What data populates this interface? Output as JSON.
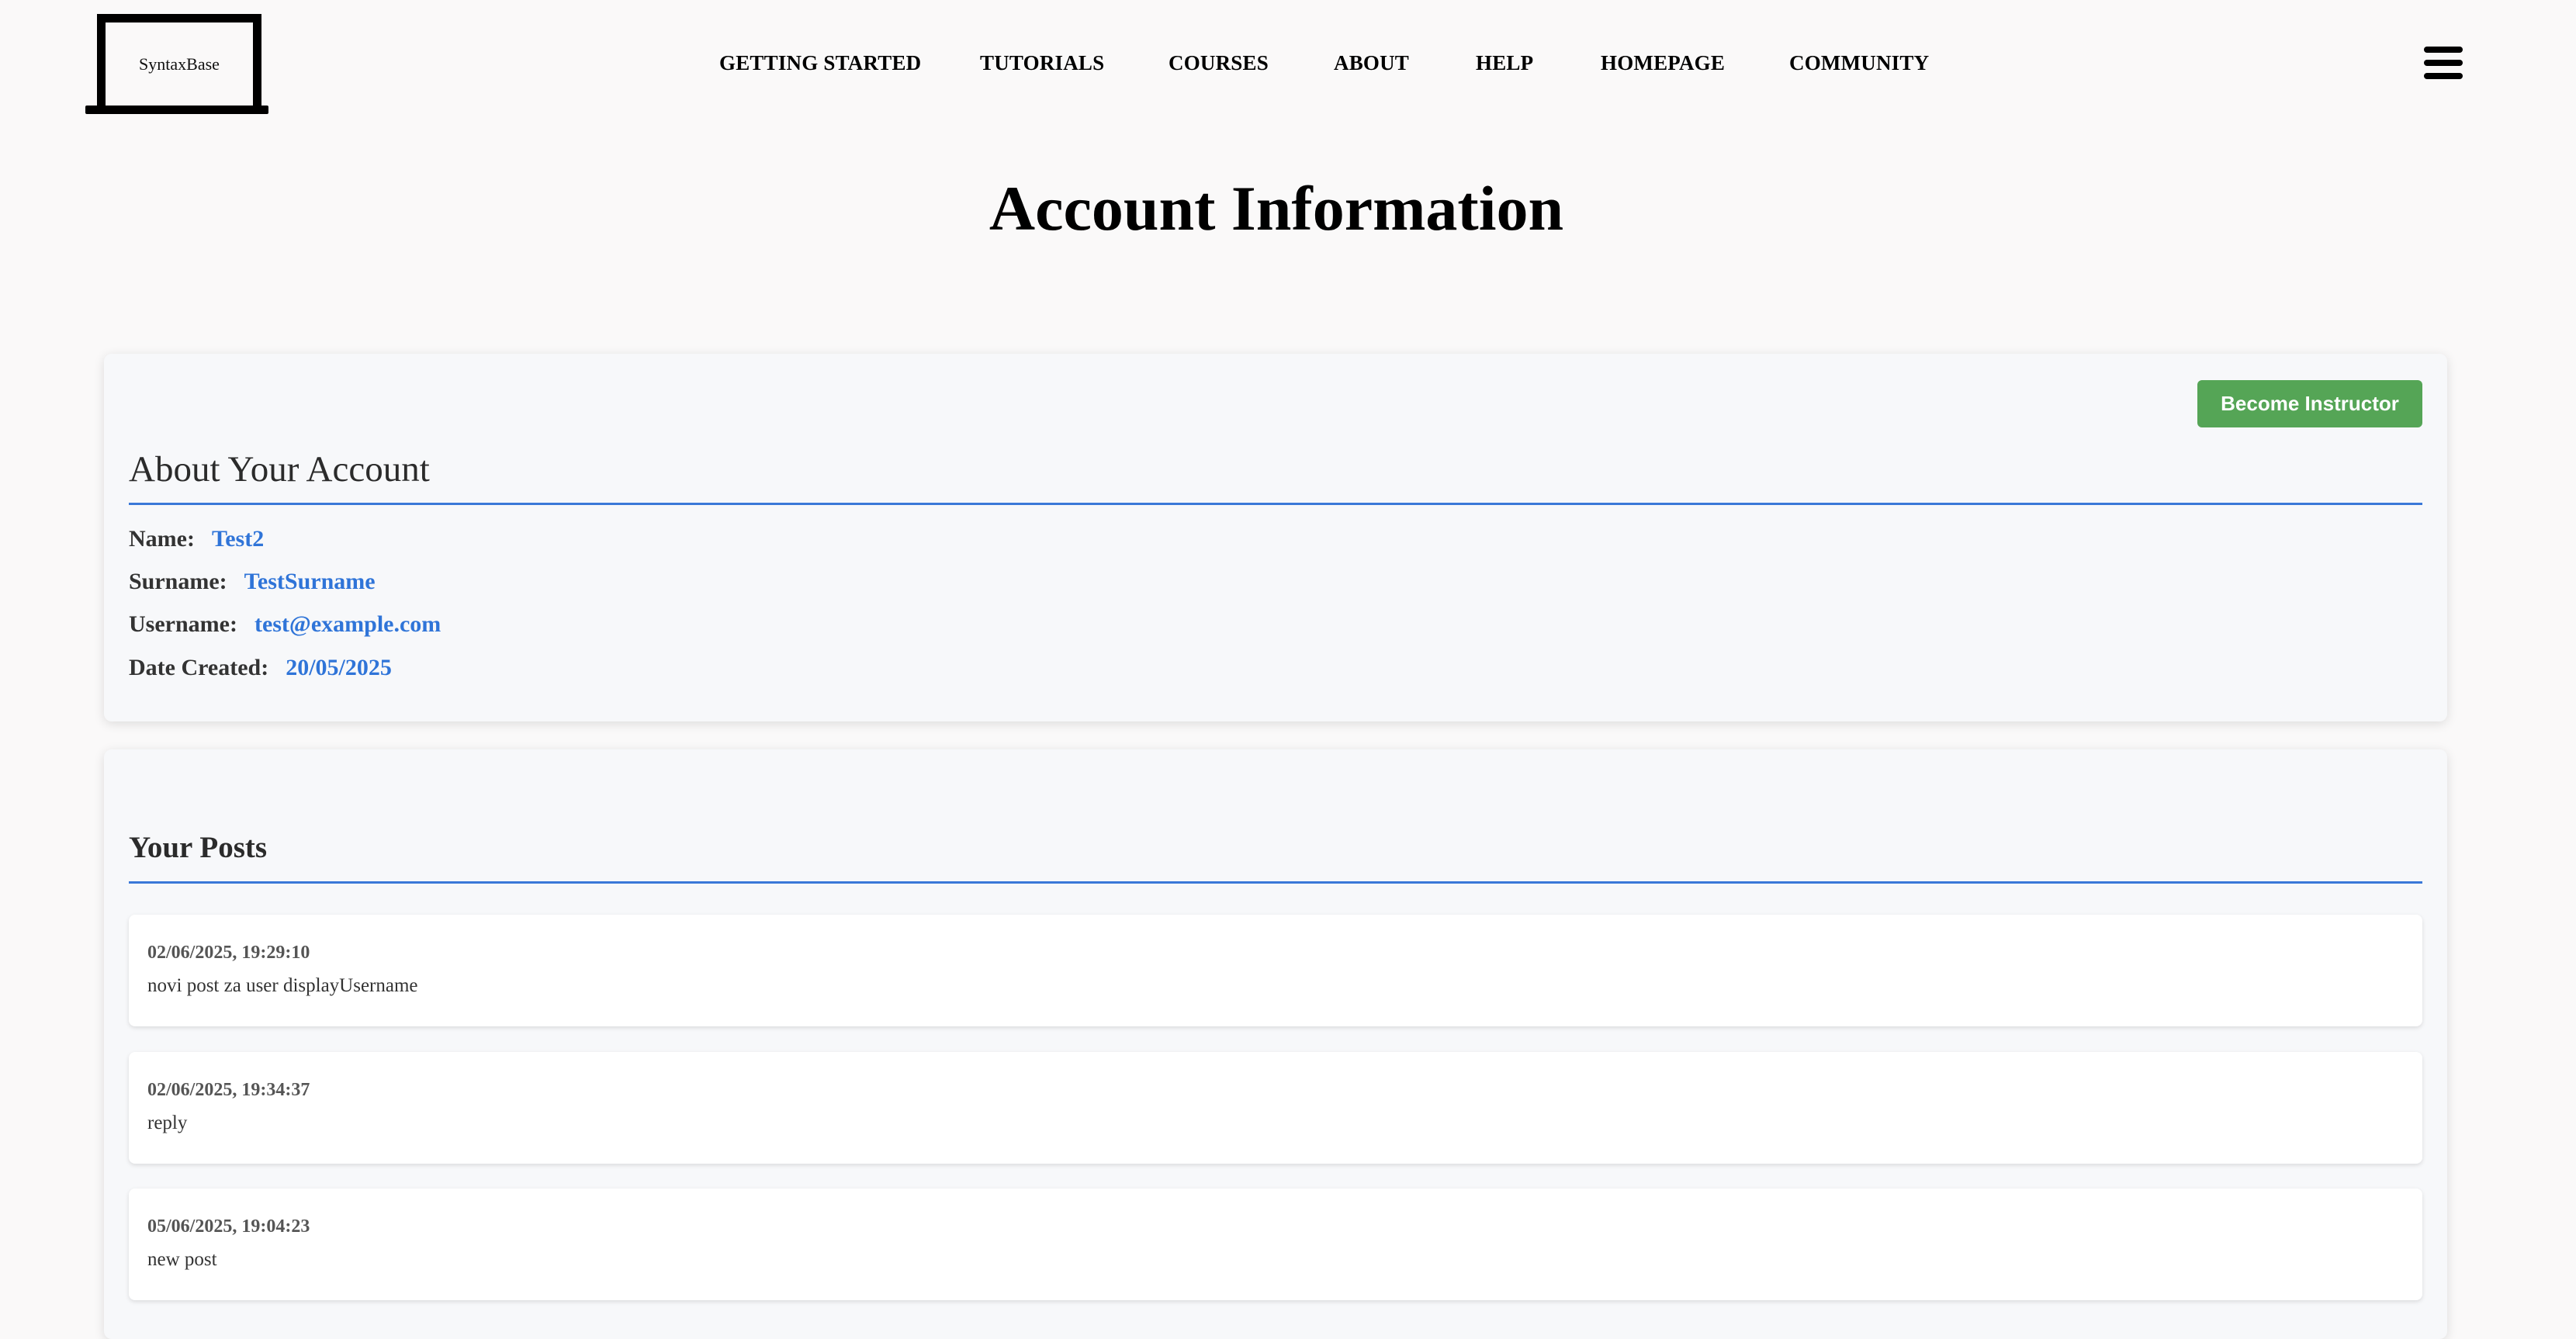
{
  "header": {
    "logo_text": "SyntaxBase",
    "nav": [
      {
        "label": "GETTING STARTED"
      },
      {
        "label": "TUTORIALS"
      },
      {
        "label": "COURSES"
      },
      {
        "label": "ABOUT"
      },
      {
        "label": "HELP"
      },
      {
        "label": "HOMEPAGE"
      },
      {
        "label": "COMMUNITY"
      }
    ],
    "menu_icon": "hamburger-menu-icon"
  },
  "page": {
    "title": "Account Information"
  },
  "account": {
    "become_instructor_label": "Become Instructor",
    "section_title": "About Your Account",
    "fields": [
      {
        "label": "Name:",
        "value": "Test2"
      },
      {
        "label": "Surname:",
        "value": "TestSurname"
      },
      {
        "label": "Username:",
        "value": "test@example.com"
      },
      {
        "label": "Date Created:",
        "value": "20/05/2025"
      }
    ]
  },
  "posts": {
    "section_title": "Your Posts",
    "items": [
      {
        "date": "02/06/2025, 19:29:10",
        "content": "novi post za user displayUsername"
      },
      {
        "date": "02/06/2025, 19:34:37",
        "content": "reply"
      },
      {
        "date": "05/06/2025, 19:04:23",
        "content": "new post"
      }
    ]
  },
  "colors": {
    "accent_blue": "#2f74d8",
    "divider_blue": "#3a78d8",
    "button_green": "#55a556",
    "page_background": "#faf9f9",
    "card_background": "#f7f8fa"
  }
}
